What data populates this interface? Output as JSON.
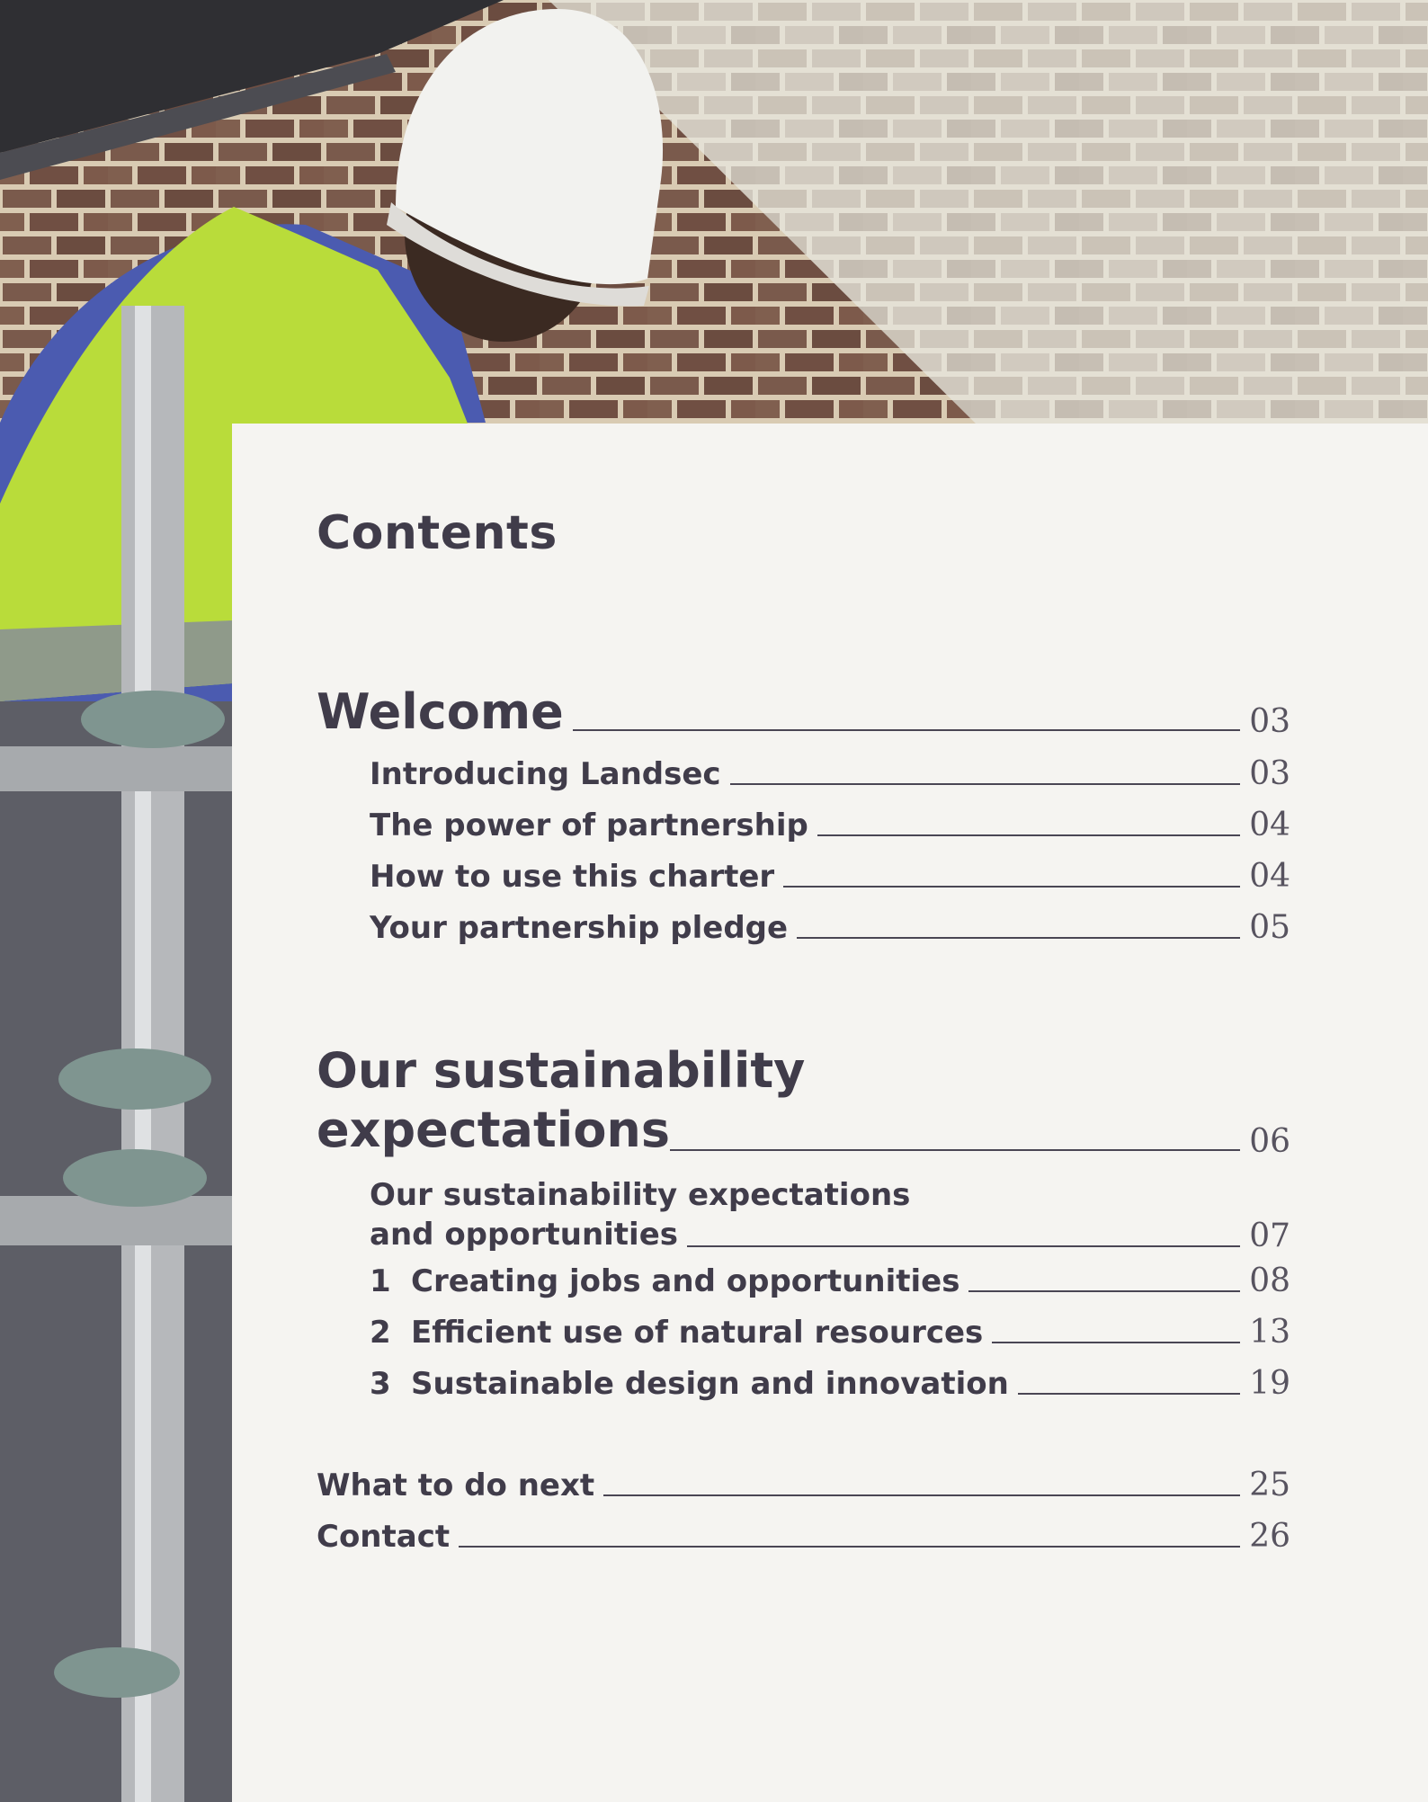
{
  "title": "Contents",
  "sections": {
    "welcome": {
      "label": "Welcome",
      "page": "03"
    },
    "introducing": {
      "label": "Introducing Landsec",
      "page": "03"
    },
    "power": {
      "label": "The power of partnership",
      "page": "04"
    },
    "how": {
      "label": "How to use this charter",
      "page": "04"
    },
    "pledge": {
      "label": "Your partnership pledge",
      "page": "05"
    },
    "sustain": {
      "line1": "Our sustainability",
      "line2": "expectations",
      "page": "06"
    },
    "sustain_sub": {
      "line1": "Our sustainability expectations",
      "line2": "and opportunities",
      "page": "07"
    },
    "jobs": {
      "num": "1",
      "label": "Creating jobs and opportunities",
      "page": "08"
    },
    "resources": {
      "num": "2",
      "label": "Efficient use of natural resources",
      "page": "13"
    },
    "design": {
      "num": "3",
      "label": "Sustainable design and innovation",
      "page": "19"
    },
    "next": {
      "label": "What to do next",
      "page": "25"
    },
    "contact": {
      "label": "Contact",
      "page": "26"
    }
  }
}
